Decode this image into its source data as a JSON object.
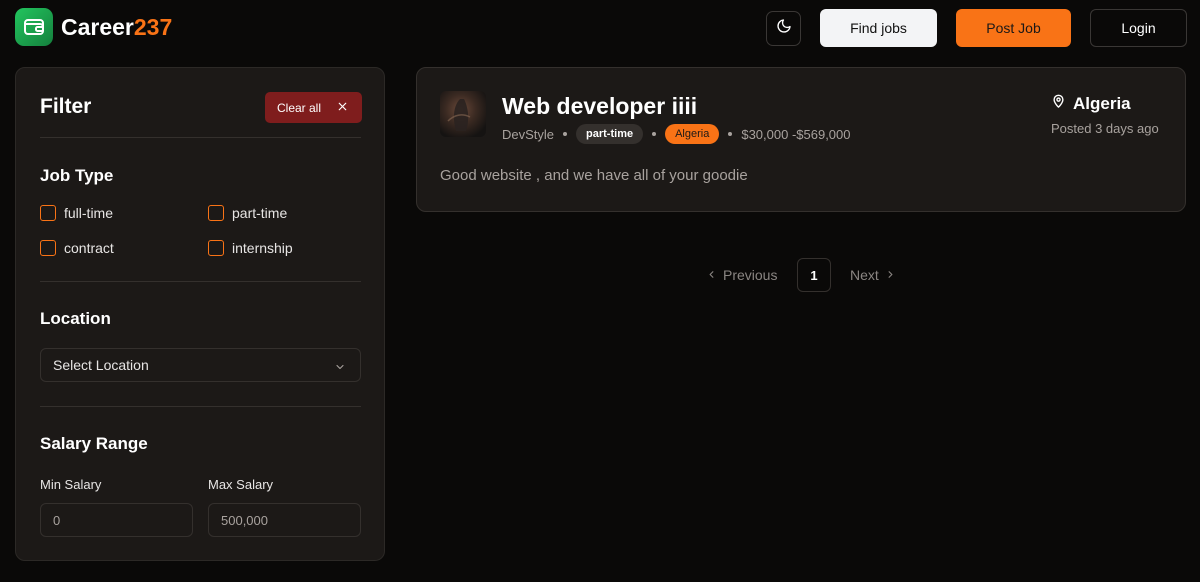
{
  "brand": {
    "name_main": "Career",
    "name_accent": "237",
    "icon": "wallet-icon",
    "icon_color": "#22c55e"
  },
  "nav": {
    "theme_icon": "moon-icon",
    "find_jobs": "Find jobs",
    "post_job": "Post Job",
    "login": "Login"
  },
  "colors": {
    "accent": "#f97316",
    "danger": "#7f1d1d",
    "background": "#0a0908",
    "panel": "#1c1917"
  },
  "filter": {
    "title": "Filter",
    "clear_label": "Clear all",
    "job_type": {
      "title": "Job Type",
      "options": [
        {
          "label": "full-time",
          "checked": false
        },
        {
          "label": "part-time",
          "checked": false
        },
        {
          "label": "contract",
          "checked": false
        },
        {
          "label": "internship",
          "checked": false
        }
      ]
    },
    "location": {
      "title": "Location",
      "placeholder": "Select Location"
    },
    "salary": {
      "title": "Salary Range",
      "min_label": "Min Salary",
      "min_value": "0",
      "max_label": "Max Salary",
      "max_value": "500,000"
    }
  },
  "job": {
    "title": "Web developer iiii",
    "company": "DevStyle",
    "type": "part-time",
    "location_tag": "Algeria",
    "salary": "$30,000 -$569,000",
    "location": "Algeria",
    "posted": "Posted 3 days ago",
    "description": "Good website , and we have all of your goodie"
  },
  "pagination": {
    "previous": "Previous",
    "current": "1",
    "next": "Next"
  }
}
